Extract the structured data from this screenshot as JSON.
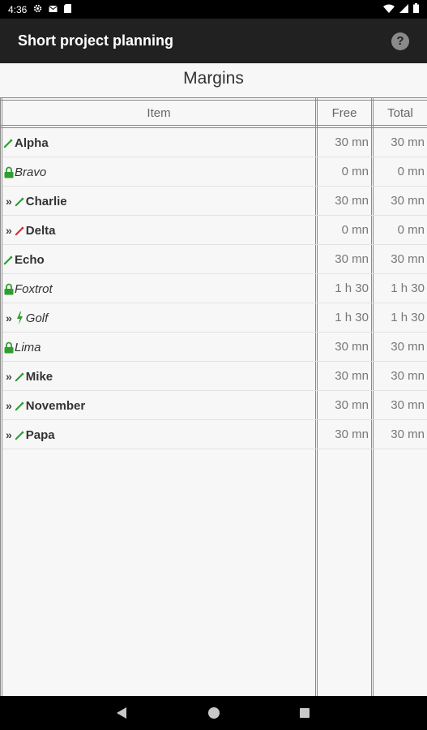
{
  "status_bar": {
    "time": "4:36",
    "icons": [
      "gear-icon",
      "mail-icon",
      "sd-card-icon"
    ],
    "right_icons": [
      "wifi-icon",
      "signal-icon",
      "battery-icon"
    ]
  },
  "app_bar": {
    "title": "Short project planning",
    "help_icon": "?"
  },
  "page_title": "Margins",
  "columns": {
    "item": "Item",
    "free": "Free",
    "total": "Total"
  },
  "rows": [
    {
      "prefix": "",
      "icon": "pencil-icon",
      "icon_color": "#2e9e2e",
      "name": "Alpha",
      "style": "bold",
      "free": "30 mn",
      "total": "30 mn"
    },
    {
      "prefix": "",
      "icon": "lock-icon",
      "icon_color": "#2e9e2e",
      "name": "Bravo",
      "style": "italic",
      "free": "0 mn",
      "total": "0 mn"
    },
    {
      "prefix": "»",
      "icon": "pencil-icon",
      "icon_color": "#2e9e2e",
      "name": "Charlie",
      "style": "bold",
      "free": "30 mn",
      "total": "30 mn"
    },
    {
      "prefix": "»",
      "icon": "pencil-icon",
      "icon_color": "#d43030",
      "name": "Delta",
      "style": "bold",
      "free": "0 mn",
      "total": "0 mn"
    },
    {
      "prefix": "",
      "icon": "pencil-icon",
      "icon_color": "#2e9e2e",
      "name": "Echo",
      "style": "bold",
      "free": "30 mn",
      "total": "30 mn"
    },
    {
      "prefix": "",
      "icon": "lock-icon",
      "icon_color": "#2e9e2e",
      "name": "Foxtrot",
      "style": "italic",
      "free": "1 h 30",
      "total": "1 h 30"
    },
    {
      "prefix": "»",
      "icon": "bolt-icon",
      "icon_color": "#2e9e2e",
      "name": "Golf",
      "style": "italic",
      "free": "1 h 30",
      "total": "1 h 30"
    },
    {
      "prefix": "",
      "icon": "lock-icon",
      "icon_color": "#2e9e2e",
      "name": "Lima",
      "style": "italic",
      "free": "30 mn",
      "total": "30 mn"
    },
    {
      "prefix": "»",
      "icon": "pencil-icon",
      "icon_color": "#2e9e2e",
      "name": "Mike",
      "style": "bold",
      "free": "30 mn",
      "total": "30 mn"
    },
    {
      "prefix": "»",
      "icon": "pencil-icon",
      "icon_color": "#2e9e2e",
      "name": "November",
      "style": "bold",
      "free": "30 mn",
      "total": "30 mn"
    },
    {
      "prefix": "»",
      "icon": "pencil-icon",
      "icon_color": "#2e9e2e",
      "name": "Papa",
      "style": "bold",
      "free": "30 mn",
      "total": "30 mn"
    }
  ],
  "nav_bar": [
    "back-icon",
    "home-icon",
    "recents-icon"
  ]
}
